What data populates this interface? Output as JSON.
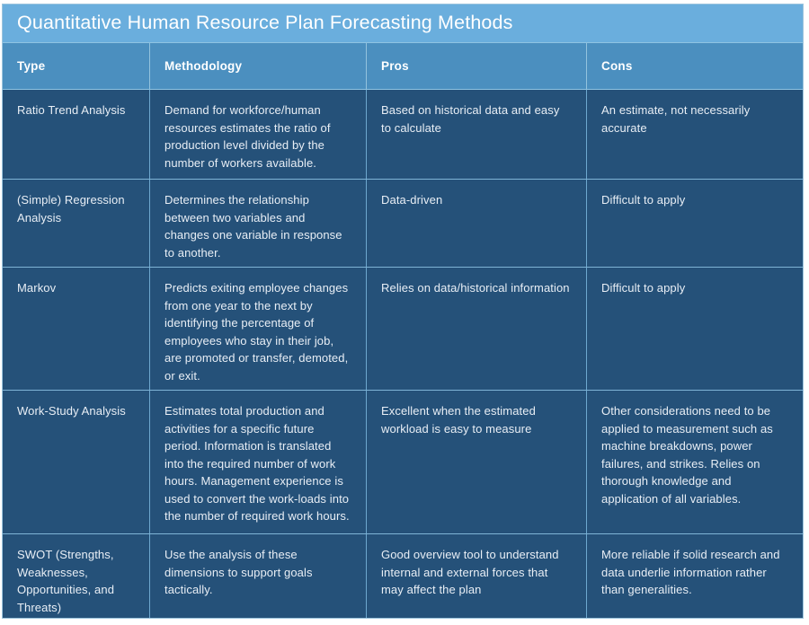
{
  "title": "Quantitative Human Resource Plan Forecasting Methods",
  "colors": {
    "title_bar": "#6aaedd",
    "header_row": "#4b8fbf",
    "body": "#255179",
    "grid_line": "#7fb4d6",
    "text": "#e8eef5",
    "header_text": "#ffffff"
  },
  "table": {
    "columns": [
      "Type",
      "Methodology",
      "Pros",
      "Cons"
    ],
    "rows": [
      {
        "type": "Ratio Trend Analysis",
        "methodology": "Demand for workforce/human resources estimates the ratio of production level divided by the number of workers available.",
        "pros": "Based on historical data and easy to calculate",
        "cons": "An estimate, not necessarily accurate"
      },
      {
        "type": "(Simple) Regression Analysis",
        "methodology": "Determines the relationship between two variables and changes one variable in response to another.",
        "pros": "Data-driven",
        "cons": "Difficult to apply"
      },
      {
        "type": "Markov",
        "methodology": "Predicts exiting employee changes from one year to the next by identifying the percentage of employees who stay in their job, are promoted or transfer, demoted, or exit.",
        "pros": "Relies on data/historical information",
        "cons": "Difficult to apply"
      },
      {
        "type": "Work-Study Analysis",
        "methodology": "Estimates total production and activities for a specific future period. Information is translated into the required number of work hours. Management experience is used to convert the work-loads into the number of required work hours.",
        "pros": "Excellent when the estimated workload is easy to measure",
        "cons": "Other considerations need to be applied to measurement such as machine breakdowns, power failures, and strikes. Relies on thorough knowledge and application of all variables."
      },
      {
        "type": "SWOT (Strengths, Weaknesses, Opportunities, and Threats)",
        "methodology": "Use the analysis of these dimensions to support goals tactically.",
        "pros": "Good overview tool to understand internal and external forces that may affect the plan",
        "cons": "More reliable if solid research and data underlie information rather than generalities."
      }
    ]
  }
}
